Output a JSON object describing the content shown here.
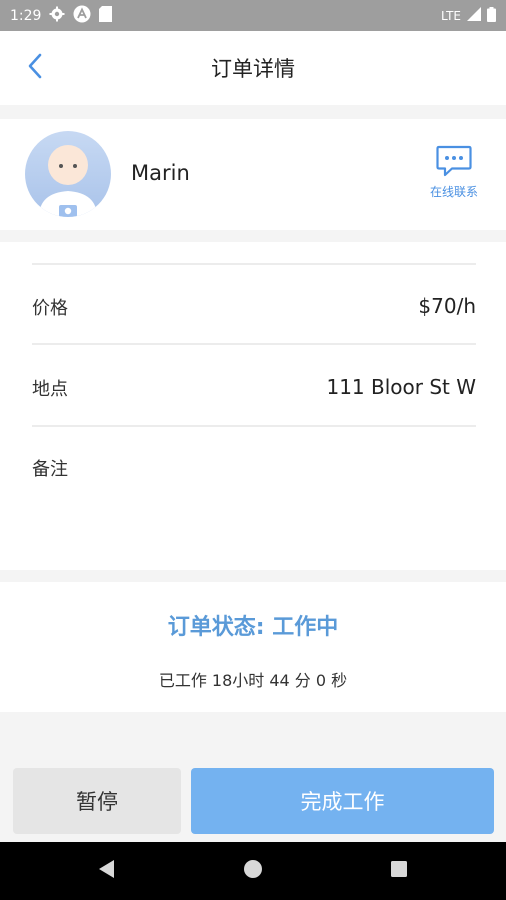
{
  "status_bar": {
    "time": "1:29",
    "network": "LTE"
  },
  "app_bar": {
    "title": "订单详情"
  },
  "profile": {
    "name": "Marin",
    "contact_label": "在线联系"
  },
  "details": {
    "price_label": "价格",
    "price_value": "$70/h",
    "location_label": "地点",
    "location_value": "111 Bloor St W",
    "notes_label": "备注",
    "notes_value": ""
  },
  "order_status": {
    "status_text": "订单状态: 工作中",
    "worked_text": "已工作 18小时 44 分 0 秒"
  },
  "actions": {
    "pause_label": "暂停",
    "finish_label": "完成工作"
  },
  "colors": {
    "accent": "#4a90e2",
    "status_blue": "#5a9ad8",
    "finish_button": "#74b2f0",
    "pause_button": "#e5e5e5",
    "status_bar": "#9e9e9e"
  },
  "icons": {
    "status_bar": [
      "settings-gear-icon",
      "app-a-icon",
      "sd-card-icon",
      "signal-icon",
      "battery-icon"
    ],
    "back": "chevron-left-icon",
    "contact": "chat-bubble-icon",
    "nav": [
      "back-triangle-icon",
      "home-circle-icon",
      "recents-square-icon"
    ]
  }
}
